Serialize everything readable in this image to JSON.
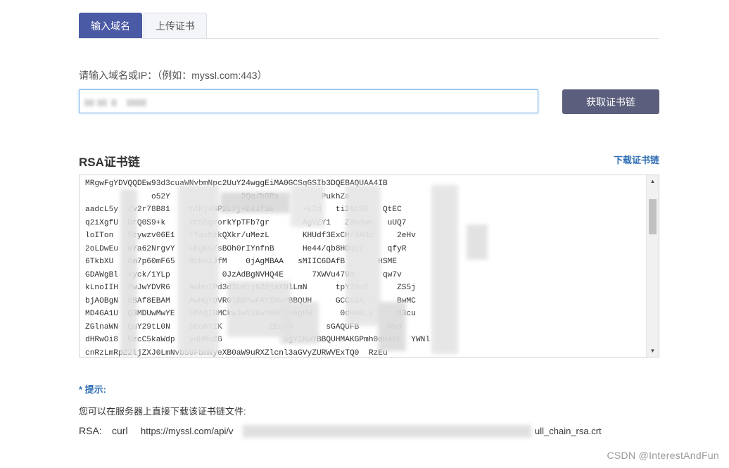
{
  "tabs": {
    "active": "输入域名",
    "inactive": "上传证书"
  },
  "form": {
    "label": "请输入域名或IP：（例如：myssl.com:443）",
    "button": "获取证书链"
  },
  "chain": {
    "title": "RSA证书链",
    "download": "下载证书链",
    "lines": [
      "MRgwFgYDVQQDEw93d3cuaWNvbmNpc2UuY24wggEiMA0GCSqGSIb3DQEBAQUAA4IB",
      "              o52Y               2Qq/bORa         PukhZa         ",
      "aadcL5y  /v2r78B81    mlPj4SP2L7j+E4JfSe      +kZd   ti2At5E   QtEC",
      "q2iXgfU  DrQ0S9+k     YcShgrorkYpTFb7gr       AgVZY1   Z8bdwe   uUQ7",
      "loITon   5tywzv06E1   rTaxBzkQXkr/uMezL       KHUdf3ExCH/4AUc     2eHv",
      "2oLDwEu  WYa62NrgvY   wEgKG/sBOh0rIYnfnB      He44/qb8HOq12     qfyR",
      "6TkbXU   6m7p60mF65   9cKmIJfM    0jAgMBAA   sMIIC6DAfB       HSME",
      "GDAWgBl  +yck/1YLp           0JzAdBgNVHQ4E      7XWVu479m      qw7v",
      "kLnoIIH  YwJwYDVR6    AwHoIPd3d3Lmljb25jaXNlLmN      tpY29uY      ZS5j",
      "bjAOBgN  8BAf8EBAM    AwHQYDVR0lBBYwFAYIKwYBBQUH     GCCsGA       BwMC",
      "MD4GA1U  Q3MDUwMwYE   EMAQIBMCkwJwYIKwYBBQUHAgEW      0dHA6Ly     d3cu",
      "ZGlnaWN  QuY29tL0N    SBoAYIK          EEdDB       sGAQUFB      hho",
      "dHRwOi8  NzcC5kaWdp   ydHMuZG             SgYIKwYBBQUHMAKGPmh0dHA6L  YWNl",
      "cnRzLmRpZ2ljZXJ0LmNvbS9FbmNyeXB0aW9uRXZlcnl3aGVyZURWVExTQ0  RzEu"
    ]
  },
  "tip": {
    "title": "* 提示:",
    "desc": "您可以在服务器上直接下载该证书链文件:",
    "label": "RSA:",
    "cmd": "curl",
    "url_start": "https://myssl.com/api/v",
    "url_end": "ull_chain_rsa.crt"
  },
  "watermark": "CSDN @InterestAndFun",
  "icons": {
    "scroll_up": "up-triangle",
    "scroll_down": "down-triangle"
  },
  "colors": {
    "tab_active": "#4b5aa5",
    "button": "#5b5e7c",
    "link": "#2f6db3",
    "input_focus_border": "#7fb2e5"
  }
}
